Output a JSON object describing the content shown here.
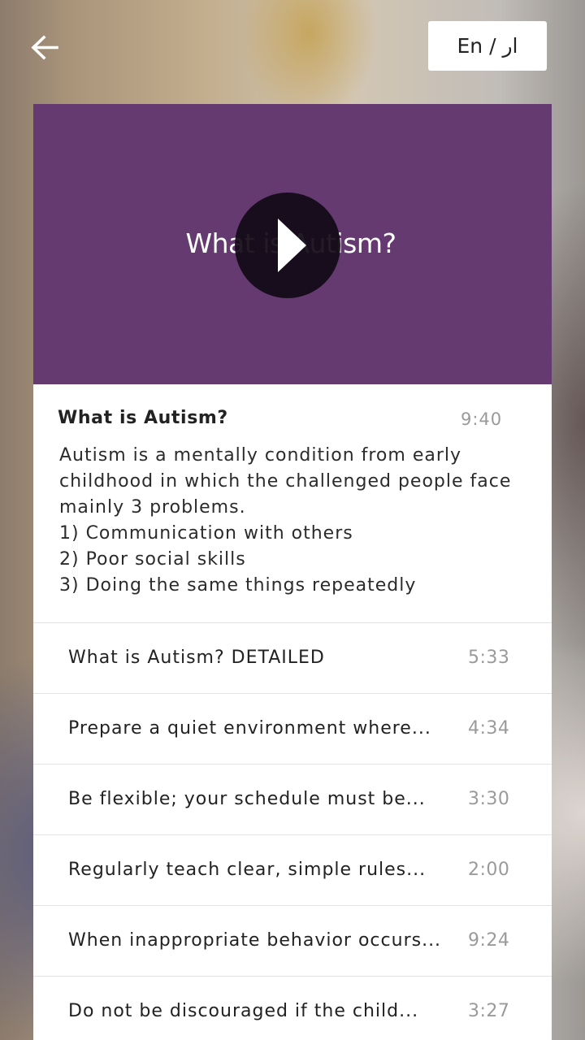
{
  "header": {
    "back_icon": "arrow-left-icon",
    "language_toggle_label": "En / ار"
  },
  "video": {
    "thumbnail_title": "What is Autism?",
    "play_icon": "play-icon",
    "background_color": "#643a71"
  },
  "current": {
    "title": "What is Autism?",
    "duration": "9:40",
    "description_lines": [
      "Autism is a mentally condition from early",
      "childhood in which the challenged people face",
      "mainly 3 problems.",
      "1) Communication with others",
      "2) Poor social skills",
      "3) Doing the same things repeatedly"
    ]
  },
  "playlist": [
    {
      "title": "What is Autism? DETAILED",
      "duration": "5:33"
    },
    {
      "title": "Prepare a quiet environment where...",
      "duration": "4:34"
    },
    {
      "title": "Be flexible; your schedule must be...",
      "duration": "3:30"
    },
    {
      "title": "Regularly teach clear, simple rules...",
      "duration": "2:00"
    },
    {
      "title": "When inappropriate behavior occurs...",
      "duration": "9:24"
    },
    {
      "title": "Do not be discouraged if the child...",
      "duration": "3:27"
    }
  ]
}
